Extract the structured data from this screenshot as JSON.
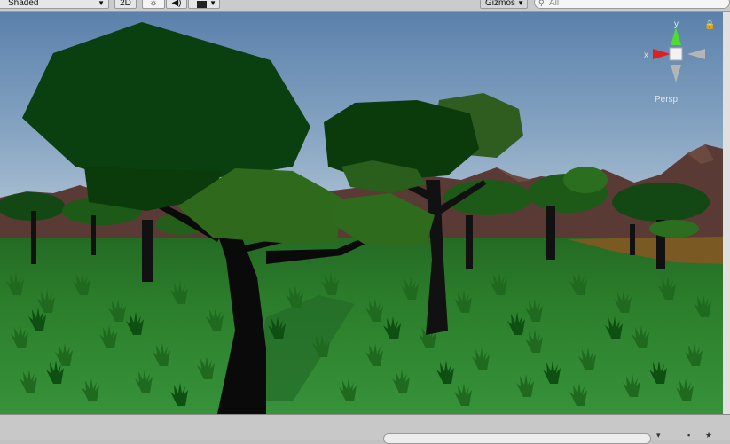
{
  "toolbar": {
    "shading_mode": "Shaded",
    "two_d_label": "2D",
    "gizmos_label": "Gizmos",
    "search_placeholder": "All"
  },
  "gizmo": {
    "y_label": "y",
    "x_label": "x",
    "projection_label": "Persp"
  },
  "icons": {
    "lighting": "sun-icon",
    "audio": "speaker-icon",
    "effects": "image-icon",
    "search": "search-icon",
    "lock": "lock-icon"
  },
  "colors": {
    "sky_top": "#5d83ad",
    "sky_horizon": "#aac2d6",
    "grass": "#2f8a2f",
    "mountain": "#5a3a34",
    "axis_y": "#4fdc2e",
    "axis_x": "#e02020",
    "canopy_dark": "#0a3d0a",
    "canopy_light": "#2f6a1c"
  }
}
